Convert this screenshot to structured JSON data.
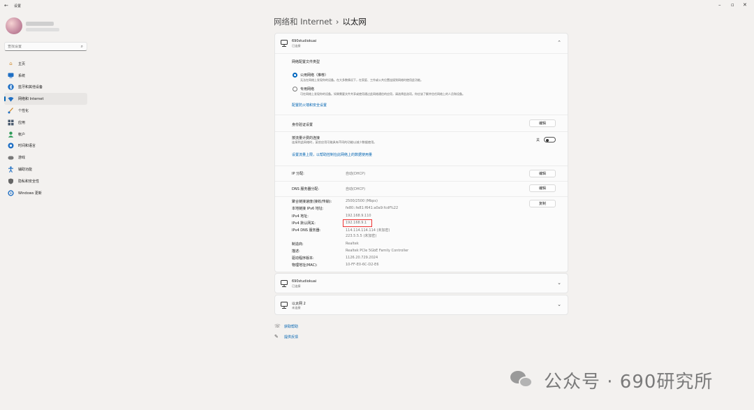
{
  "titlebar": {
    "back_icon": "back-arrow-icon",
    "title": "设置",
    "minimize": "–",
    "maximize": "▫",
    "close": "✕"
  },
  "user": {
    "avatar_icon": "avatar-icon"
  },
  "search": {
    "placeholder": "查找设置",
    "icon": "search-icon"
  },
  "sidebar": {
    "items": [
      {
        "label": "主页",
        "icon": "home-icon",
        "color": "#d08a2c"
      },
      {
        "label": "系统",
        "icon": "monitor-icon",
        "color": "#1f6fc4"
      },
      {
        "label": "蓝牙和其他设备",
        "icon": "bluetooth-icon",
        "color": "#1f6fc4"
      },
      {
        "label": "网络和 Internet",
        "icon": "wifi-icon",
        "color": "#1f6fc4",
        "active": true
      },
      {
        "label": "个性化",
        "icon": "brush-icon",
        "color": "#d08a2c"
      },
      {
        "label": "应用",
        "icon": "apps-icon",
        "color": "#4a5a6e"
      },
      {
        "label": "帐户",
        "icon": "person-icon",
        "color": "#2e9b58"
      },
      {
        "label": "时间和语言",
        "icon": "globe-icon",
        "color": "#1f6fc4"
      },
      {
        "label": "游戏",
        "icon": "gamepad-icon",
        "color": "#777"
      },
      {
        "label": "辅助功能",
        "icon": "accessibility-icon",
        "color": "#1f6fc4"
      },
      {
        "label": "隐私和安全性",
        "icon": "shield-icon",
        "color": "#666"
      },
      {
        "label": "Windows 更新",
        "icon": "update-icon",
        "color": "#1f6fc4"
      }
    ]
  },
  "breadcrumb": {
    "parent": "网络和 Internet",
    "separator": "›",
    "current": "以太网"
  },
  "adapter1": {
    "name": "690studiokuai",
    "status": "已连接",
    "chevron": "⌃",
    "profile_title": "网络配置文件类型",
    "public_label": "公用网络（推荐）",
    "public_desc": "无法在网络上发现你的设备。在大多数情况下，在家庭、工作或公共位置连接到网络时使用此功能。",
    "private_label": "专用网络",
    "private_desc": "可在网络上发现你的设备。如果需要文件共享或使用通过此网络通信的应用，请选择此选项。你应该了解并信任网络上的人员和设备。",
    "firewall_link": "配置防火墙和安全设置",
    "auth_label": "身份验证设置",
    "auth_btn": "编辑",
    "metered_title": "按流量计费的连接",
    "metered_desc": "连接到此网络时，某些应用可能具有不同的功能以减少数据使用。",
    "metered_state": "关",
    "datalimit_link": "设置流量上限，以帮助控制在此网络上的数据使用量",
    "ip_assign_label": "IP 分配:",
    "ip_assign_val": "自动(DHCP)",
    "ip_assign_btn": "编辑",
    "dns_assign_label": "DNS 服务器分配:",
    "dns_assign_val": "自动(DHCP)",
    "dns_assign_btn": "编辑",
    "copy_btn": "复制",
    "props": [
      {
        "label": "聚合链接速度(接收/传输):",
        "value": "2500/2500 (Mbps)"
      },
      {
        "label": "本地链接 IPv6 地址:",
        "value": "fe80::fe81:f641:a0a9:fcdf%22"
      },
      {
        "label": "IPv4 地址:",
        "value": "192.168.9.110"
      },
      {
        "label": "IPv4 默认网关:",
        "value": "192.168.9.1"
      },
      {
        "label": "IPv4 DNS 服务器:",
        "value": "114.114.114.114 (未加密)"
      },
      {
        "label": "",
        "value": "223.5.5.5 (未加密)"
      },
      {
        "label": "制造商:",
        "value": "Realtek"
      },
      {
        "label": "描述:",
        "value": "Realtek PCIe 5GbE Family Controller"
      },
      {
        "label": "驱动程序版本:",
        "value": "1126.20.729.2024"
      },
      {
        "label": "物理地址(MAC):",
        "value": "10-FF-E0-6C-D2-E6"
      }
    ]
  },
  "adapter2": {
    "name": "690studiokuai",
    "status": "已连接",
    "chevron": "⌄"
  },
  "adapter3": {
    "name": "以太网 2",
    "status": "未连接",
    "chevron": "⌄"
  },
  "help": {
    "get_help": "获取帮助",
    "feedback": "提供反馈"
  },
  "watermark": {
    "text": "公众号 · 690研究所",
    "icon": "wechat-icon"
  }
}
